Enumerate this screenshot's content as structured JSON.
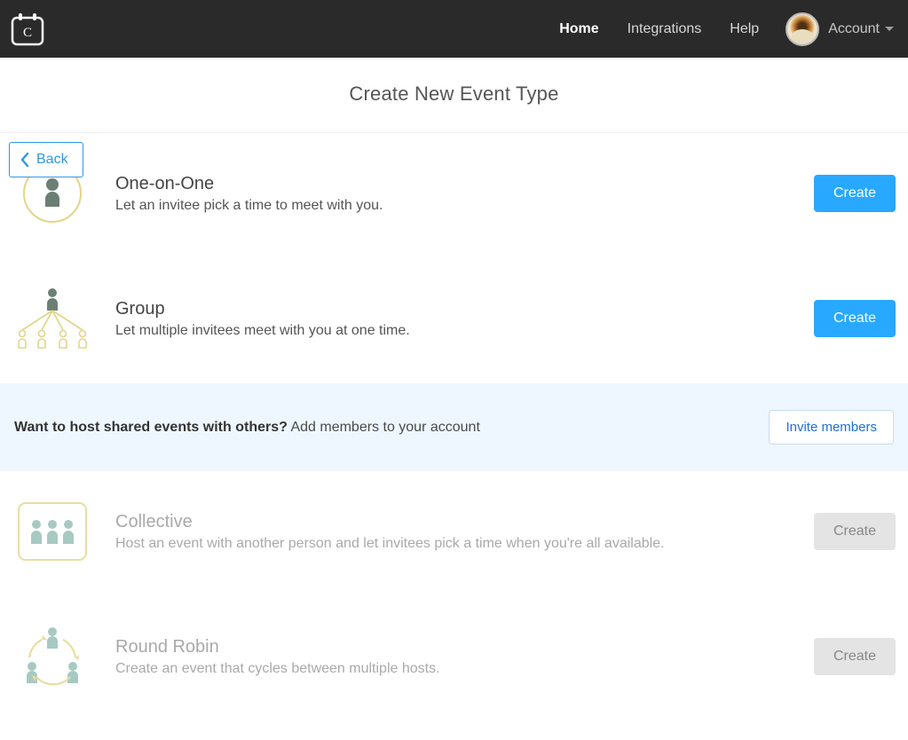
{
  "nav": {
    "home": "Home",
    "integrations": "Integrations",
    "help": "Help",
    "account": "Account"
  },
  "page": {
    "title": "Create New Event Type",
    "back": "Back"
  },
  "banner": {
    "bold": "Want to host shared events with others?",
    "rest": " Add members to your account",
    "invite": "Invite members"
  },
  "types": {
    "oneonone": {
      "name": "One-on-One",
      "desc": "Let an invitee pick a time to meet with you.",
      "cta": "Create"
    },
    "group": {
      "name": "Group",
      "desc": "Let multiple invitees meet with you at one time.",
      "cta": "Create"
    },
    "collective": {
      "name": "Collective",
      "desc": "Host an event with another person and let invitees pick a time when you're all available.",
      "cta": "Create"
    },
    "roundrobin": {
      "name": "Round Robin",
      "desc": "Create an event that cycles between multiple hosts.",
      "cta": "Create"
    }
  }
}
